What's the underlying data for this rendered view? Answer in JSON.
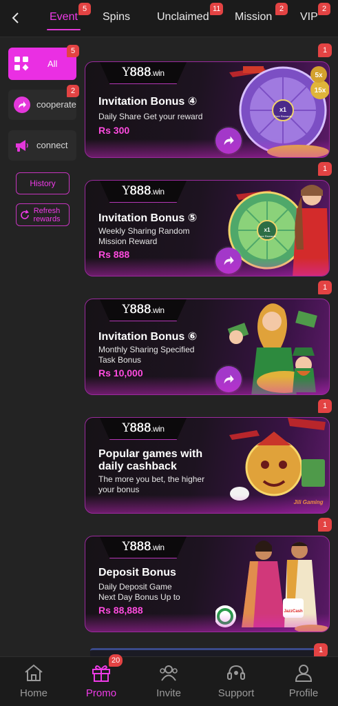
{
  "top_tabs": [
    {
      "label": "Event",
      "badge": "5",
      "active": true
    },
    {
      "label": "Spins",
      "badge": ""
    },
    {
      "label": "Unclaimed",
      "badge": "11"
    },
    {
      "label": "Mission",
      "badge": "2"
    },
    {
      "label": "VIP",
      "badge": "2"
    }
  ],
  "sidebar": {
    "all": {
      "label": "All",
      "badge": "5"
    },
    "items": [
      {
        "label": "cooperate",
        "icon": "share-arrow-icon",
        "badge": "2"
      },
      {
        "label": "connect",
        "icon": "megaphone-icon",
        "badge": ""
      }
    ],
    "history_label": "History",
    "refresh_label": "Refresh\nrewards"
  },
  "brand": {
    "logo_prefix": "Y",
    "logo_digits": "888",
    "logo_suffix": ".win"
  },
  "cards": [
    {
      "title": "Invitation Bonus ④",
      "subtitle": "Daily Share Get your reward",
      "amount": "Rs 300",
      "badge": "1",
      "art": "purple-prize-wheel",
      "wheel_text": "x1",
      "wheel_sub": "Free Rewards",
      "multipliers": [
        "5x",
        "15x"
      ]
    },
    {
      "title": "Invitation Bonus ⑤",
      "subtitle": "Weekly Sharing Random Mission Reward",
      "amount": "Rs 888",
      "badge": "1",
      "art": "green-prize-wheel",
      "wheel_text": "x1",
      "wheel_sub": "Free Rewards"
    },
    {
      "title": "Invitation Bonus ⑥",
      "subtitle": "Monthly Sharing Specified Task Bonus",
      "amount": "Rs 10,000",
      "badge": "1",
      "art": "cash-girl-leprechaun"
    },
    {
      "title": "Popular games with daily cashback",
      "subtitle": "The more you bet, the higher your bonus",
      "amount": "",
      "badge": "1",
      "art": "golden-mask-plane",
      "provider": "Jili Gaming"
    },
    {
      "title": "Deposit Bonus",
      "subtitle": "Daily Deposit Game Next Day Bonus Up to",
      "amount": "Rs 88,888",
      "badge": "1",
      "art": "dancing-couple",
      "payment_logo": "JazzCash"
    }
  ],
  "peek_badge": "1",
  "bottom_nav": [
    {
      "label": "Home",
      "icon": "home-icon"
    },
    {
      "label": "Promo",
      "icon": "gift-icon",
      "badge": "20",
      "active": true
    },
    {
      "label": "Invite",
      "icon": "users-icon"
    },
    {
      "label": "Support",
      "icon": "headset-icon"
    },
    {
      "label": "Profile",
      "icon": "person-icon"
    }
  ],
  "colors": {
    "accent": "#ee3be7",
    "badge": "#e34343",
    "bg": "#232323",
    "amount": "#ff4be0"
  }
}
